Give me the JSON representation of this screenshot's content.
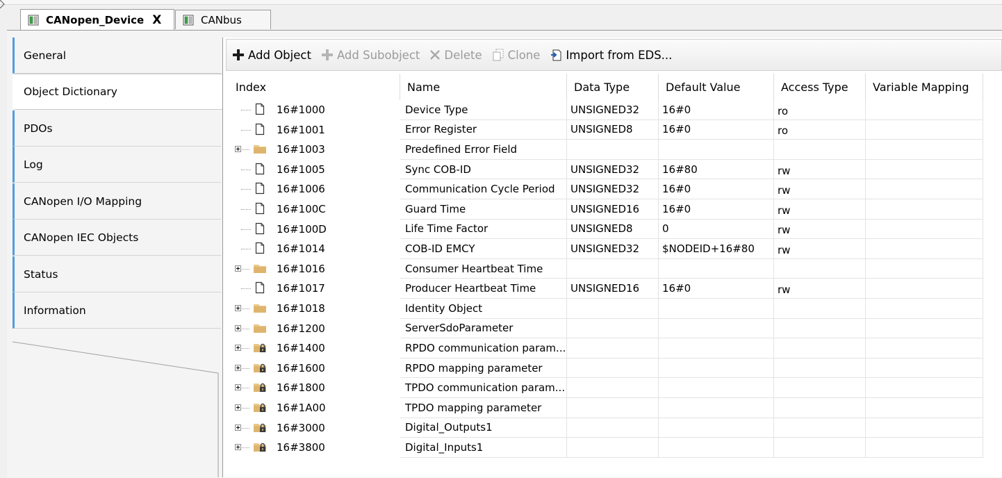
{
  "tabs": [
    {
      "label": "CANopen_Device",
      "active": true,
      "close": "X"
    },
    {
      "label": "CANbus",
      "active": false
    }
  ],
  "nav": [
    {
      "label": "General"
    },
    {
      "label": "Object Dictionary",
      "selected": true
    },
    {
      "label": "PDOs"
    },
    {
      "label": "Log"
    },
    {
      "label": "CANopen I/O Mapping"
    },
    {
      "label": "CANopen IEC Objects"
    },
    {
      "label": "Status"
    },
    {
      "label": "Information"
    }
  ],
  "toolbar": {
    "add_object": "Add Object",
    "add_subobject": "Add Subobject",
    "delete": "Delete",
    "clone": "Clone",
    "import_eds": "Import from EDS..."
  },
  "table": {
    "columns": [
      "Index",
      "Name",
      "Data Type",
      "Default Value",
      "Access Type",
      "Variable Mapping"
    ],
    "rows": [
      {
        "icon": "file",
        "index": "16#1000",
        "name": "Device Type",
        "type": "UNSIGNED32",
        "default": "16#0",
        "access": "ro",
        "mapping": ""
      },
      {
        "icon": "file",
        "index": "16#1001",
        "name": "Error Register",
        "type": "UNSIGNED8",
        "default": "16#0",
        "access": "ro",
        "mapping": ""
      },
      {
        "icon": "folder",
        "index": "16#1003",
        "name": "Predefined Error Field",
        "type": "",
        "default": "",
        "access": "",
        "mapping": ""
      },
      {
        "icon": "file",
        "index": "16#1005",
        "name": "Sync COB-ID",
        "type": "UNSIGNED32",
        "default": "16#80",
        "access": "rw",
        "mapping": ""
      },
      {
        "icon": "file",
        "index": "16#1006",
        "name": "Communication Cycle Period",
        "type": "UNSIGNED32",
        "default": "16#0",
        "access": "rw",
        "mapping": ""
      },
      {
        "icon": "file",
        "index": "16#100C",
        "name": "Guard Time",
        "type": "UNSIGNED16",
        "default": "16#0",
        "access": "rw",
        "mapping": ""
      },
      {
        "icon": "file",
        "index": "16#100D",
        "name": "Life Time Factor",
        "type": "UNSIGNED8",
        "default": "0",
        "access": "rw",
        "mapping": ""
      },
      {
        "icon": "file",
        "index": "16#1014",
        "name": "COB-ID EMCY",
        "type": "UNSIGNED32",
        "default": "$NODEID+16#80",
        "access": "rw",
        "mapping": ""
      },
      {
        "icon": "folder",
        "index": "16#1016",
        "name": "Consumer Heartbeat Time",
        "type": "",
        "default": "",
        "access": "",
        "mapping": ""
      },
      {
        "icon": "file",
        "index": "16#1017",
        "name": "Producer Heartbeat Time",
        "type": "UNSIGNED16",
        "default": "16#0",
        "access": "rw",
        "mapping": ""
      },
      {
        "icon": "folder",
        "index": "16#1018",
        "name": "Identity Object",
        "type": "",
        "default": "",
        "access": "",
        "mapping": ""
      },
      {
        "icon": "folder",
        "index": "16#1200",
        "name": "ServerSdoParameter",
        "type": "",
        "default": "",
        "access": "",
        "mapping": ""
      },
      {
        "icon": "folder-lock",
        "index": "16#1400",
        "name": "RPDO communication param...",
        "type": "",
        "default": "",
        "access": "",
        "mapping": ""
      },
      {
        "icon": "folder-lock",
        "index": "16#1600",
        "name": "RPDO mapping parameter",
        "type": "",
        "default": "",
        "access": "",
        "mapping": ""
      },
      {
        "icon": "folder-lock",
        "index": "16#1800",
        "name": "TPDO communication param...",
        "type": "",
        "default": "",
        "access": "",
        "mapping": ""
      },
      {
        "icon": "folder-lock",
        "index": "16#1A00",
        "name": "TPDO mapping parameter",
        "type": "",
        "default": "",
        "access": "",
        "mapping": ""
      },
      {
        "icon": "folder-lock",
        "index": "16#3000",
        "name": "Digital_Outputs1",
        "type": "",
        "default": "",
        "access": "",
        "mapping": ""
      },
      {
        "icon": "folder-lock",
        "index": "16#3800",
        "name": "Digital_Inputs1",
        "type": "",
        "default": "",
        "access": "",
        "mapping": ""
      }
    ]
  },
  "colors": {
    "nav_accent": "#4f9de0",
    "folder": "#e8c88a",
    "add_icon": "#1a1a1a",
    "disabled_text": "#9b9b9b"
  }
}
